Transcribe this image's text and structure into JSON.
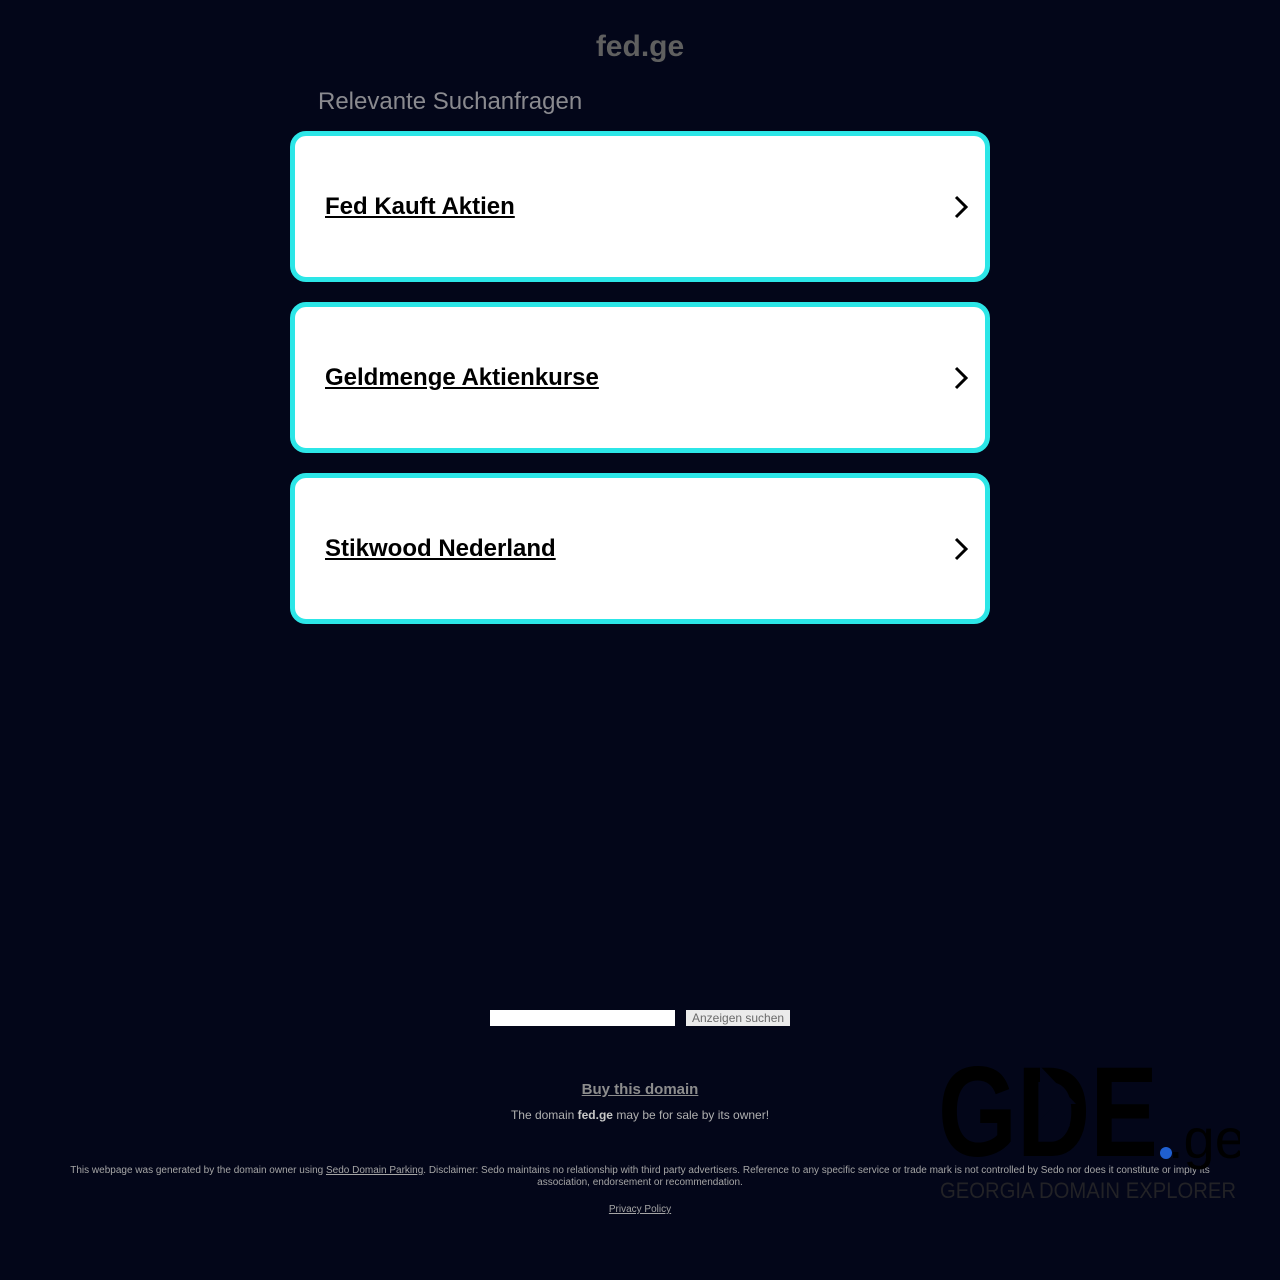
{
  "header": {
    "domain": "fed.ge",
    "related_heading": "Relevante Suchanfragen"
  },
  "ads": [
    {
      "label": "Fed Kauft Aktien",
      "icon": "chevron-right-icon"
    },
    {
      "label": "Geldmenge Aktienkurse",
      "icon": "chevron-right-icon"
    },
    {
      "label": "Stikwood Nederland",
      "icon": "chevron-right-icon"
    }
  ],
  "search": {
    "value": "",
    "button_label": "Anzeigen suchen"
  },
  "sale": {
    "buy_label": "Buy this domain",
    "text_before": "The domain ",
    "domain": "fed.ge",
    "text_after": " may be for sale by its owner!"
  },
  "footer": {
    "disclaimer_before": "This webpage was generated by the domain owner using ",
    "parking_link": "Sedo Domain Parking",
    "disclaimer_after": ". Disclaimer: Sedo maintains no relationship with third party advertisers. Reference to any specific service or trade mark is not controlled by Sedo nor does it constitute or imply its association, endorsement or recommendation.",
    "privacy_label": "Privacy Policy"
  },
  "logo": {
    "main": "GDE",
    "suffix": ".ge",
    "tagline": "GEORGIA DOMAIN EXPLORER"
  },
  "colors": {
    "background": "#030619",
    "card_border": "#2ce6e7",
    "logo_dot": "#1f5fd0"
  }
}
